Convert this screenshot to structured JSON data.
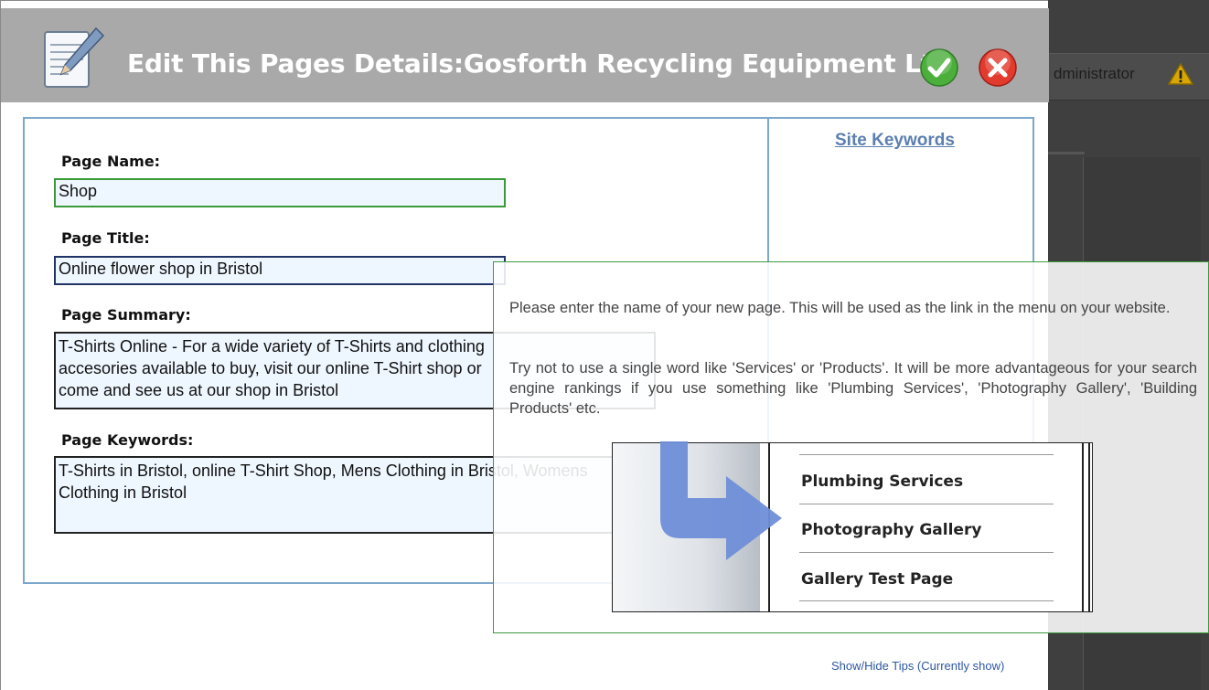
{
  "dialog": {
    "title": "Edit This Pages Details:Gosforth Recycling Equipment Ltd",
    "icons": {
      "header": "notepad-pencil-icon",
      "ok": "check-icon",
      "cancel": "close-icon"
    },
    "colors": {
      "header_bg": "#a9a9a9",
      "ok": "#4caf3c",
      "cancel": "#e23b2e",
      "field_bg": "#eef6ff",
      "link": "#5b7fb0"
    }
  },
  "backdrop": {
    "user_label": "dministrator",
    "warning_icon": "warning-icon"
  },
  "form": {
    "page_name": {
      "label": "Page Name:",
      "value": "Shop"
    },
    "page_title": {
      "label": "Page Title:",
      "value": "Online flower shop in Bristol"
    },
    "page_summary": {
      "label": "Page Summary:",
      "value": "T-Shirts Online - For a wide variety of T-Shirts and clothing accesories available to buy, visit our online T-Shirt shop or come and see us at our shop in Bristol"
    },
    "page_keywords": {
      "label": "Page Keywords:",
      "value": "T-Shirts in Bristol, online T-Shirt Shop, Mens Clothing in Bristol, Womens Clothing in Bristol"
    }
  },
  "sidebar": {
    "site_keywords_link": "Site Keywords"
  },
  "tip": {
    "paragraph1": "Please enter the name of your new page. This will be used as the link in the menu on your website.",
    "paragraph2": "Try not to use a single word like 'Services' or 'Products'. It will be more advantageous for your search engine rankings if you use something like 'Plumbing Services', 'Photography Gallery', 'Building Products' etc.",
    "menu_items": [
      "Plumbing Services",
      "Photography Gallery",
      "Gallery Test Page"
    ],
    "arrow_icon": "arrow-right-icon"
  },
  "footer": {
    "show_hide_tips": "Show/Hide Tips (Currently show)"
  }
}
